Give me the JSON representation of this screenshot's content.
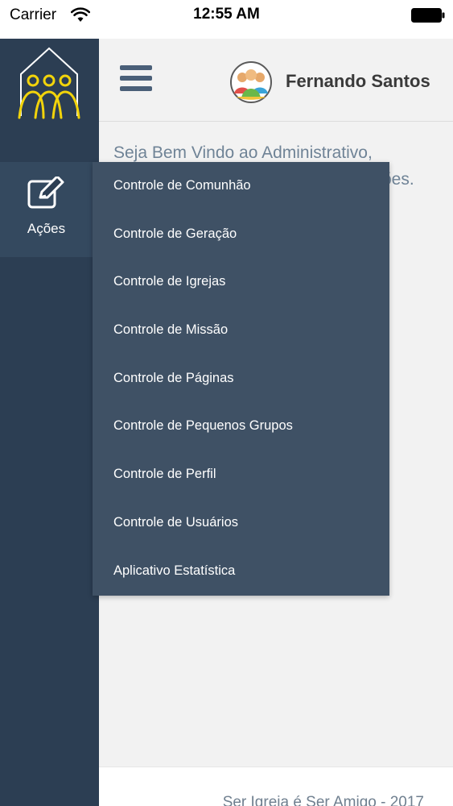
{
  "status_bar": {
    "carrier": "Carrier",
    "time": "12:55 AM"
  },
  "sidebar": {
    "logo_icon": "church-people-logo-icon",
    "active_item": {
      "icon": "edit-icon",
      "label": "Ações"
    }
  },
  "header": {
    "menu_icon": "hamburger-icon",
    "avatar_icon": "group-avatar-icon",
    "user_name": "Fernando Santos"
  },
  "content": {
    "welcome_text": "Seja Bem Vindo ao Administrativo, ",
    "welcome_hidden_tail": "ões."
  },
  "dropdown": {
    "items": [
      {
        "label": "Controle de Comunhão"
      },
      {
        "label": "Controle de Geração"
      },
      {
        "label": "Controle de Igrejas"
      },
      {
        "label": "Controle de Missão"
      },
      {
        "label": "Controle de Páginas"
      },
      {
        "label": "Controle de Pequenos Grupos"
      },
      {
        "label": "Controle de Perfil"
      },
      {
        "label": "Controle de Usuários"
      },
      {
        "label": "Aplicativo Estatística"
      }
    ]
  },
  "footer": {
    "text": "Ser Igreja é Ser Amigo - 2017"
  },
  "colors": {
    "sidebar": "#2c3e53",
    "dropdown": "#3f5165",
    "logo_yellow": "#f2d40b",
    "header_bg": "#f2f2f2"
  }
}
